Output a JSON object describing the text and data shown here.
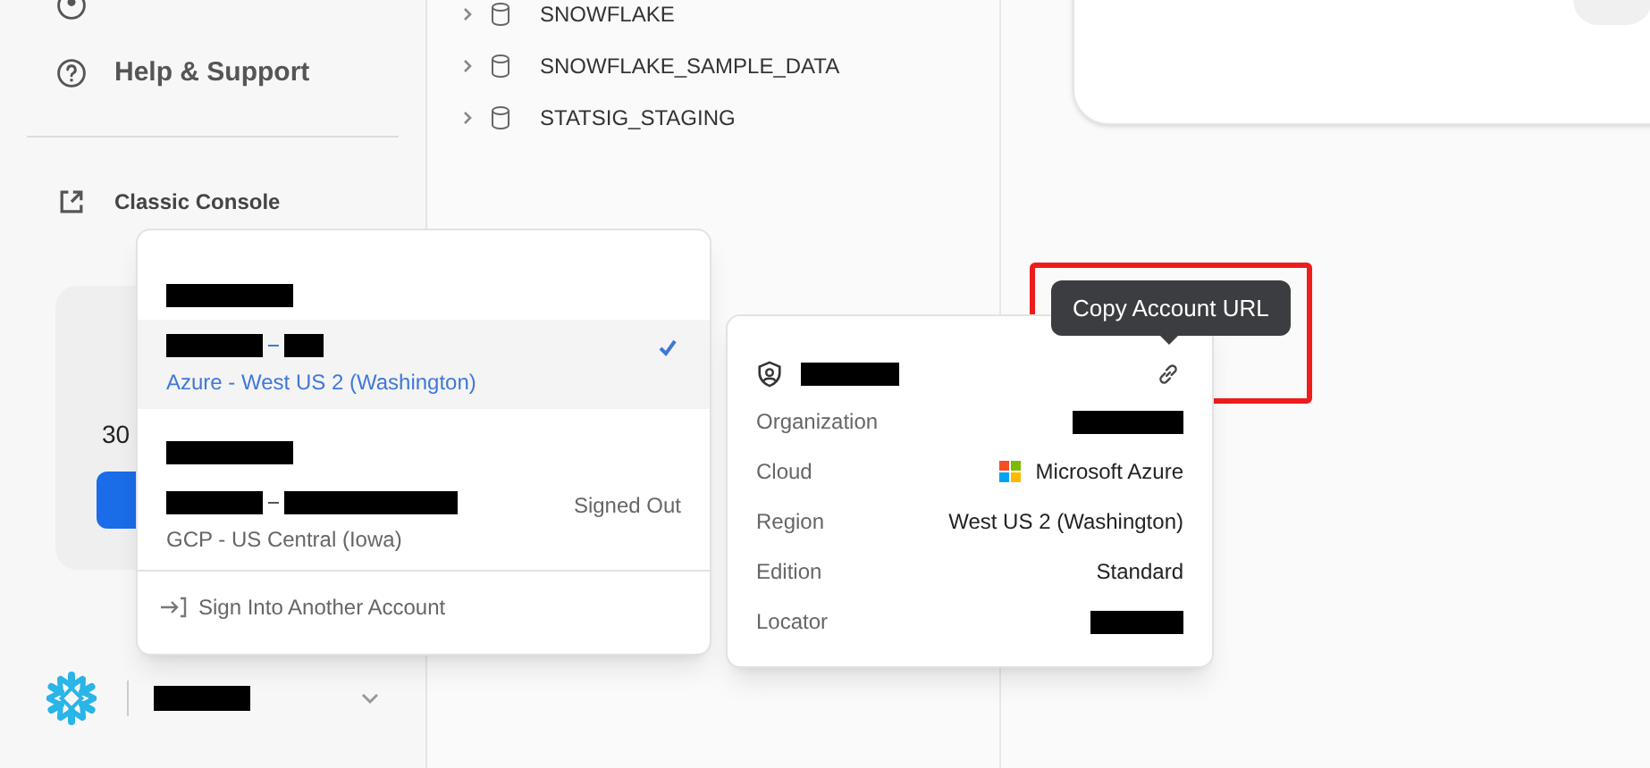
{
  "sidebar": {
    "nav_items": [
      {
        "kind": "admin"
      },
      {
        "label": "Help & Support",
        "kind": "help"
      },
      {
        "label": "Classic Console",
        "kind": "external"
      }
    ],
    "trial_card": {
      "text": "30"
    }
  },
  "database_tree": [
    {
      "name": "SNOWFLAKE",
      "expanded": false
    },
    {
      "name": "SNOWFLAKE_SAMPLE_DATA",
      "expanded": false
    },
    {
      "name": "STATSIG_STAGING",
      "expanded": false
    }
  ],
  "top_card": {
    "tag": {
      "kind": "pill"
    }
  },
  "account_menu": {
    "accounts": [
      {
        "region": "Azure - West US 2 (Washington)",
        "selected": true
      },
      {
        "region": "GCP - US Central (Iowa)",
        "selected": false,
        "status": "Signed Out"
      }
    ],
    "sign_in_label": "Sign Into Another Account"
  },
  "account_details": {
    "rows": [
      {
        "label": "Organization",
        "kind": "redacted"
      },
      {
        "label": "Cloud",
        "kind": "cloud",
        "value": "Microsoft Azure"
      },
      {
        "label": "Region",
        "kind": "text",
        "value": "West US 2 (Washington)"
      },
      {
        "label": "Edition",
        "kind": "text",
        "value": "Standard"
      },
      {
        "label": "Locator",
        "kind": "redacted"
      }
    ]
  },
  "tooltip": {
    "text": "Copy Account URL"
  }
}
